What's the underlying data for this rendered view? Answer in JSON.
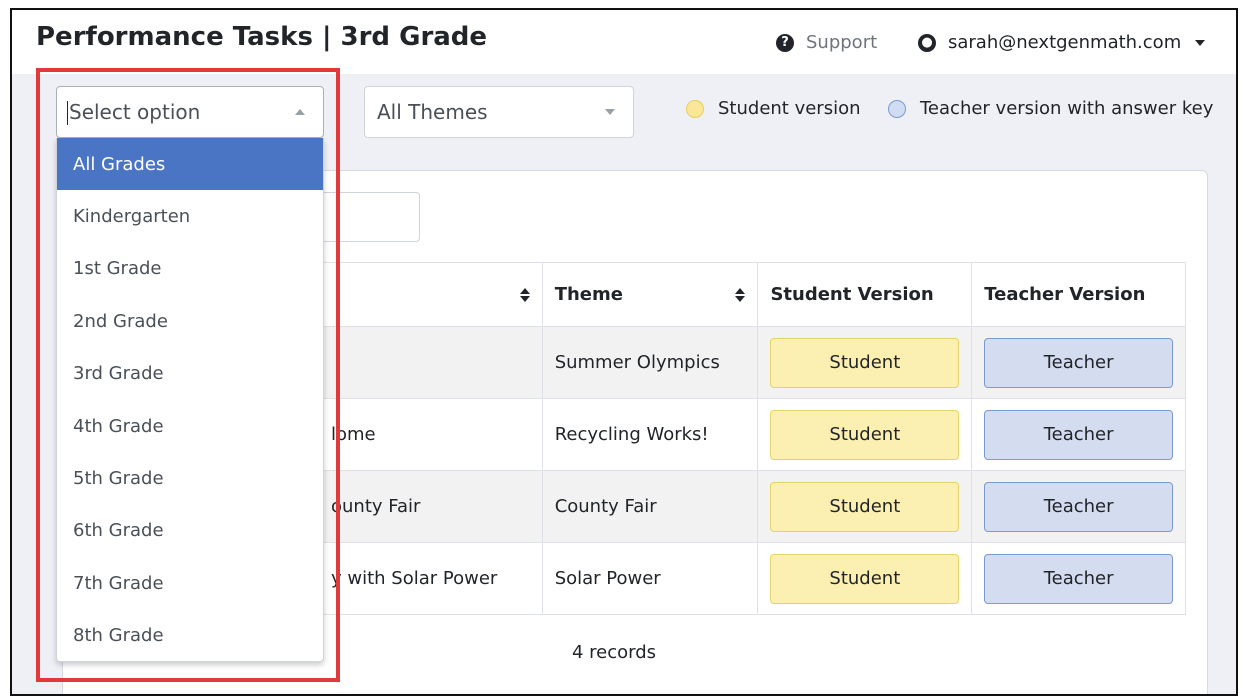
{
  "header": {
    "title": "Performance Tasks | 3rd Grade",
    "support_label": "Support",
    "user_email": "sarah@nextgenmath.com"
  },
  "filters": {
    "grade_select": {
      "placeholder": "Select option",
      "open": true
    },
    "theme_select": {
      "value": "All Themes"
    }
  },
  "legend": {
    "student": {
      "label": "Student version",
      "color": "#fbe79a"
    },
    "teacher": {
      "label": "Teacher version with answer key",
      "color": "#cfdcf2"
    }
  },
  "grade_options": [
    "All Grades",
    "Kindergarten",
    "1st Grade",
    "2nd Grade",
    "3rd Grade",
    "4th Grade",
    "5th Grade",
    "6th Grade",
    "7th Grade",
    "8th Grade"
  ],
  "selected_grade_option": "All Grades",
  "table": {
    "columns": [
      "",
      "Theme",
      "Student Version",
      "Teacher Version"
    ],
    "rows": [
      {
        "title": "",
        "theme": "Summer Olympics",
        "student_label": "Student",
        "teacher_label": "Teacher"
      },
      {
        "title": "lome",
        "theme": "Recycling Works!",
        "student_label": "Student",
        "teacher_label": "Teacher"
      },
      {
        "title": "ounty Fair",
        "theme": "County Fair",
        "student_label": "Student",
        "teacher_label": "Teacher"
      },
      {
        "title": "y with Solar Power",
        "theme": "Solar Power",
        "student_label": "Student",
        "teacher_label": "Teacher"
      }
    ]
  },
  "records_count": "4 records",
  "colors": {
    "accent": "#4a74c4",
    "highlight": "#e03a3a",
    "student_button": "#fbf0b2",
    "teacher_button": "#d3ddef"
  }
}
